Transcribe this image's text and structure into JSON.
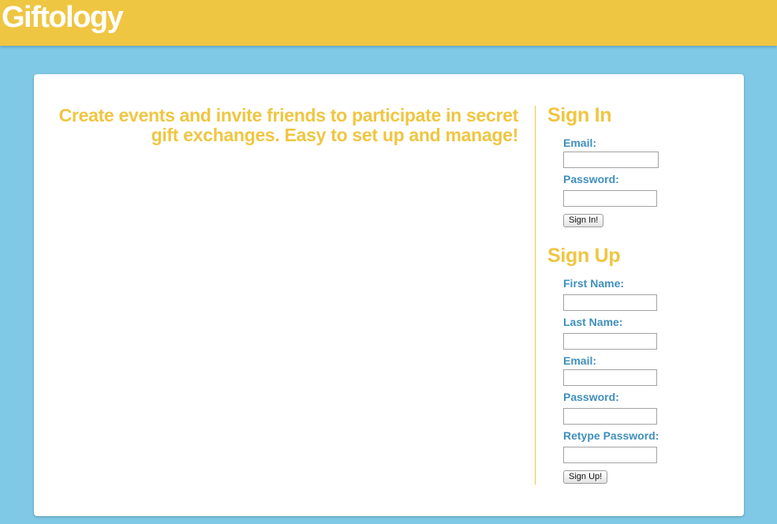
{
  "header": {
    "brand": "Giftology"
  },
  "main": {
    "tagline": "Create events and invite friends to participate in secret gift exchanges. Easy to set up and manage!"
  },
  "sign_in": {
    "title": "Sign In",
    "email_label": "Email:",
    "email_value": "",
    "password_label": "Password:",
    "password_value": "",
    "submit_label": "Sign In!"
  },
  "sign_up": {
    "title": "Sign Up",
    "first_name_label": "First Name:",
    "first_name_value": "",
    "last_name_label": "Last Name:",
    "last_name_value": "",
    "email_label": "Email:",
    "email_value": "",
    "password_label": "Password:",
    "password_value": "",
    "retype_password_label": "Retype Password:",
    "retype_password_value": "",
    "submit_label": "Sign Up!"
  },
  "colors": {
    "header_bg": "#efc642",
    "page_bg": "#7fc9e6",
    "accent_yellow": "#efc642",
    "label_blue": "#3f8fbd"
  }
}
